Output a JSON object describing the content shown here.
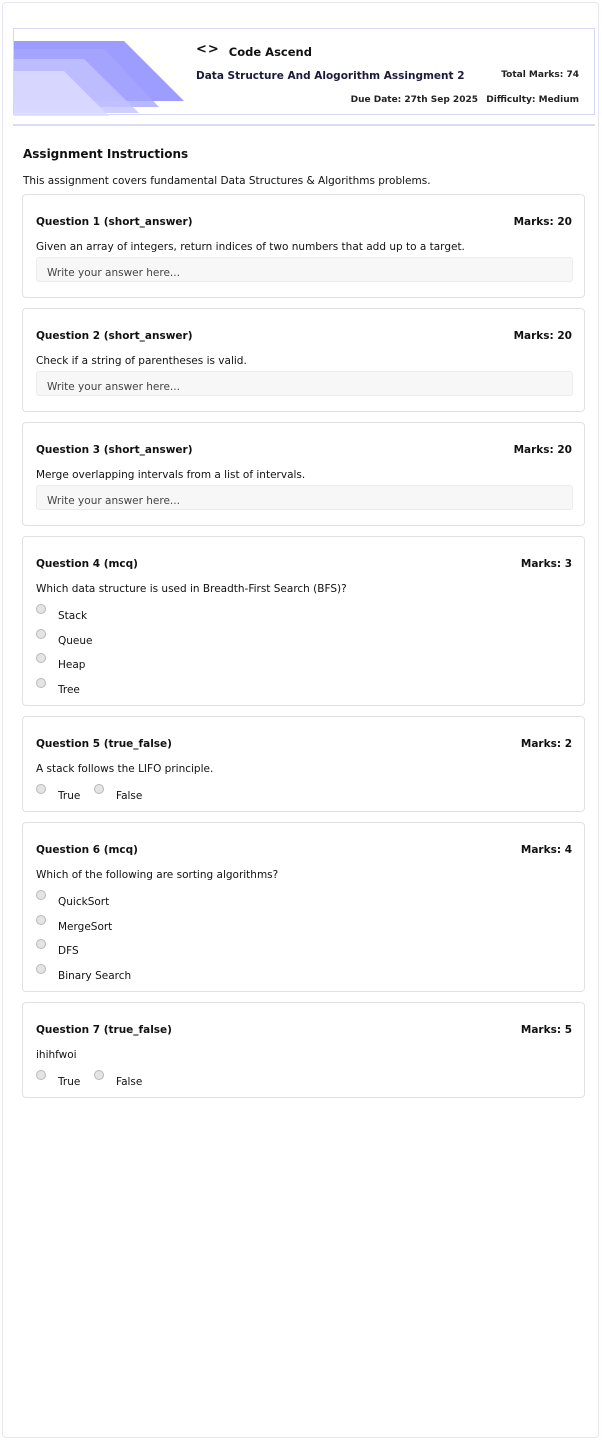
{
  "header": {
    "brand_icon": "<>",
    "brand_name": "Code Ascend",
    "assignment_title": "Data Structure And Alogorithm Assingment 2",
    "total_marks": "Total Marks: 74",
    "due_date": "Due Date: 27th Sep 2025",
    "difficulty": "Difficulty: Medium",
    "banner_color": "#8c8cff"
  },
  "instructions": {
    "title": "Assignment Instructions",
    "text": "This assignment covers fundamental Data Structures & Algorithms problems."
  },
  "questions": [
    {
      "title": "Question 1 (short_answer)",
      "marks": "Marks: 20",
      "text": "Given an array of integers, return indices of two numbers that add up to a target.",
      "placeholder": "Write your answer here..."
    },
    {
      "title": "Question 2 (short_answer)",
      "marks": "Marks: 20",
      "text": "Check if a string of parentheses is valid.",
      "placeholder": "Write your answer here..."
    },
    {
      "title": "Question 3 (short_answer)",
      "marks": "Marks: 20",
      "text": "Merge overlapping intervals from a list of intervals.",
      "placeholder": "Write your answer here..."
    },
    {
      "title": "Question 4 (mcq)",
      "marks": "Marks: 3",
      "text": "Which data structure is used in Breadth-First Search (BFS)?",
      "options": [
        "Stack",
        "Queue",
        "Heap",
        "Tree"
      ]
    },
    {
      "title": "Question 5 (true_false)",
      "marks": "Marks: 2",
      "text": "A stack follows the LIFO principle.",
      "options": [
        "True",
        "False"
      ]
    },
    {
      "title": "Question 6 (mcq)",
      "marks": "Marks: 4",
      "text": "Which of the following are sorting algorithms?",
      "options": [
        "QuickSort",
        "MergeSort",
        "DFS",
        "Binary Search"
      ]
    },
    {
      "title": "Question 7 (true_false)",
      "marks": "Marks: 5",
      "text": "ihihfwoi",
      "options": [
        "True",
        "False"
      ]
    }
  ]
}
